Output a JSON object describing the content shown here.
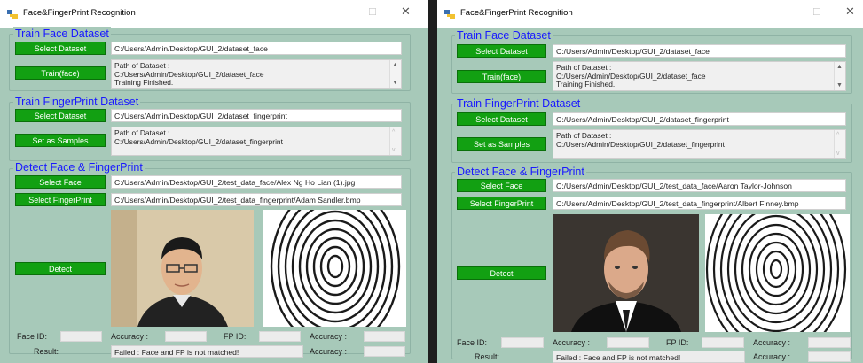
{
  "left": {
    "title": "Face&FingerPrint Recognition",
    "controls": {
      "minimize": "—",
      "maximize": "□",
      "close": "✕"
    },
    "train_face": {
      "heading": "Train Face Dataset",
      "select_label": "Select Dataset",
      "path": "C:/Users/Admin/Desktop/GUI_2/dataset_face",
      "train_label": "Train(face)",
      "log": [
        "Path of Dataset :",
        "C:/Users/Admin/Desktop/GUI_2/dataset_face",
        "Training Finished."
      ]
    },
    "train_fp": {
      "heading": "Train FingerPrint Dataset",
      "select_label": "Select Dataset",
      "path": "C:/Users/Admin/Desktop/GUI_2/dataset_fingerprint",
      "samples_label": "Set as Samples",
      "log": [
        "Path of Dataset :",
        "C:/Users/Admin/Desktop/GUI_2/dataset_fingerprint"
      ]
    },
    "detect": {
      "heading": "Detect Face & FingerPrint",
      "face_label": "Select Face",
      "face_path": "C:/Users/Admin/Desktop/GUI_2/test_data_face/Alex Ng Ho Lian (1).jpg",
      "fp_label": "Select FingerPrint",
      "fp_path": "C:/Users/Admin/Desktop/GUI_2/test_data_fingerprint/Adam Sandler.bmp",
      "detect_label": "Detect"
    },
    "status": {
      "face_id": "Face ID:",
      "accuracy1": "Accuracy :",
      "fp_id": "FP ID:",
      "accuracy2": "Accuracy :",
      "result": "Result:",
      "result_value": "Failed : Face and FP is not matched!",
      "accuracy3": "Accuracy :"
    }
  },
  "right": {
    "title": "Face&FingerPrint Recognition",
    "controls": {
      "minimize": "—",
      "maximize": "□",
      "close": "✕"
    },
    "train_face": {
      "heading": "Train Face Dataset",
      "select_label": "Select Dataset",
      "path": "C:/Users/Admin/Desktop/GUI_2/dataset_face",
      "train_label": "Train(face)",
      "log": [
        "Path of Dataset :",
        "C:/Users/Admin/Desktop/GUI_2/dataset_face",
        "Training Finished."
      ]
    },
    "train_fp": {
      "heading": "Train FingerPrint Dataset",
      "select_label": "Select Dataset",
      "path": "C:/Users/Admin/Desktop/GUI_2/dataset_fingerprint",
      "samples_label": "Set as Samples",
      "log": [
        "Path of Dataset :",
        "C:/Users/Admin/Desktop/GUI_2/dataset_fingerprint"
      ]
    },
    "detect": {
      "heading": "Detect Face & FingerPrint",
      "face_label": "Select Face",
      "face_path": "C:/Users/Admin/Desktop/GUI_2/test_data_face/Aaron Taylor-Johnson",
      "fp_label": "Select FingerPrint",
      "fp_path": "C:/Users/Admin/Desktop/GUI_2/test_data_fingerprint/Albert Finney.bmp",
      "detect_label": "Detect"
    },
    "status": {
      "face_id": "Face ID:",
      "accuracy1": "Accuracy :",
      "fp_id": "FP ID:",
      "accuracy2": "Accuracy :",
      "result": "Result:",
      "result_value": "Failed : Face and FP is not matched!",
      "accuracy3": "Accuracy :"
    }
  },
  "colors": {
    "window_bg": "#a7c9b9",
    "button": "#12a012",
    "heading": "#1919ff"
  }
}
